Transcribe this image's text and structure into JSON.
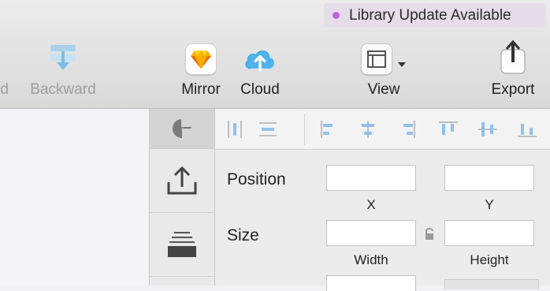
{
  "toolbar": {
    "notice": "Library Update Available",
    "notice_dot_color": "#c35fe1",
    "cut_label": "rd",
    "backward_label": "Backward",
    "mirror_label": "Mirror",
    "cloud_label": "Cloud",
    "view_label": "View",
    "export_label": "Export"
  },
  "inspector": {
    "rail": [
      "inspector-icon",
      "export-icon",
      "layers-icon"
    ],
    "position_label": "Position",
    "x_label": "X",
    "y_label": "Y",
    "size_label": "Size",
    "width_label": "Width",
    "height_label": "Height",
    "position_x": "",
    "position_y": "",
    "size_width": "",
    "size_height": "",
    "accent_color": "#8fc1ee"
  }
}
